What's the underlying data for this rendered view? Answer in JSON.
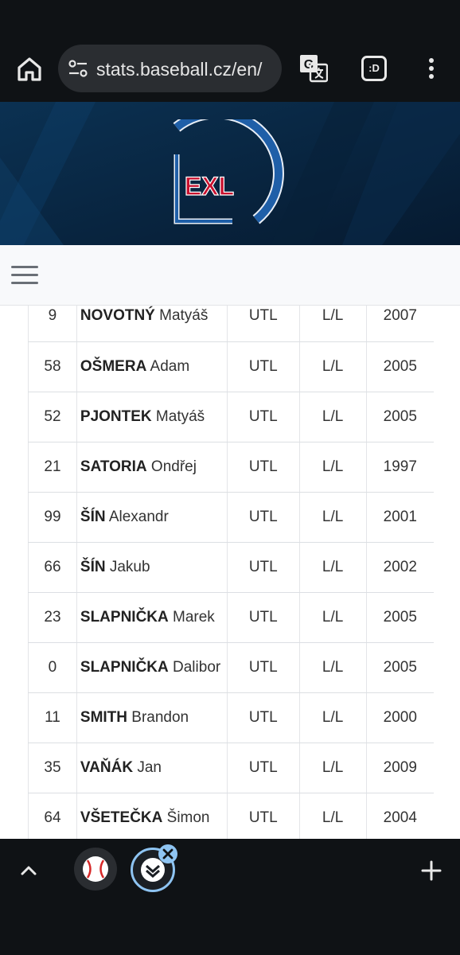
{
  "browser": {
    "url": "stats.baseball.cz/en/",
    "tabs_label": ":D"
  },
  "site": {
    "logo_text": "EXL"
  },
  "roster": [
    {
      "number": "9",
      "last": "NOVOTNÝ",
      "first": "Matyáš",
      "pos": "UTL",
      "bt": "L/L",
      "year": "2007"
    },
    {
      "number": "58",
      "last": "OŠMERA",
      "first": "Adam",
      "pos": "UTL",
      "bt": "L/L",
      "year": "2005"
    },
    {
      "number": "52",
      "last": "PJONTEK",
      "first": "Matyáš",
      "pos": "UTL",
      "bt": "L/L",
      "year": "2005"
    },
    {
      "number": "21",
      "last": "SATORIA",
      "first": "Ondřej",
      "pos": "UTL",
      "bt": "L/L",
      "year": "1997"
    },
    {
      "number": "99",
      "last": "ŠÍN",
      "first": "Alexandr",
      "pos": "UTL",
      "bt": "L/L",
      "year": "2001"
    },
    {
      "number": "66",
      "last": "ŠÍN",
      "first": "Jakub",
      "pos": "UTL",
      "bt": "L/L",
      "year": "2002"
    },
    {
      "number": "23",
      "last": "SLAPNIČKA",
      "first": "Marek",
      "pos": "UTL",
      "bt": "L/L",
      "year": "2005"
    },
    {
      "number": "0",
      "last": "SLAPNIČKA",
      "first": "Dalibor",
      "pos": "UTL",
      "bt": "L/L",
      "year": "2005"
    },
    {
      "number": "11",
      "last": "SMITH",
      "first": "Brandon",
      "pos": "UTL",
      "bt": "L/L",
      "year": "2000"
    },
    {
      "number": "35",
      "last": "VAŇÁK",
      "first": "Jan",
      "pos": "UTL",
      "bt": "L/L",
      "year": "2009"
    },
    {
      "number": "64",
      "last": "VŠETEČKA",
      "first": "Šimon",
      "pos": "UTL",
      "bt": "L/L",
      "year": "2004"
    }
  ],
  "colors": {
    "chrome_bg": "#0f1215",
    "banner_bg": "#0a2540",
    "logo_blue": "#1f5fa8",
    "logo_red": "#c8102e",
    "tab_accent": "#8ec4f2"
  },
  "icons": {
    "home": "home-icon",
    "tune": "tune-icon",
    "translate": "translate-icon",
    "menu": "more-vert-icon",
    "hamburger": "hamburger-icon",
    "up": "chevron-up-icon",
    "plus": "plus-icon"
  }
}
